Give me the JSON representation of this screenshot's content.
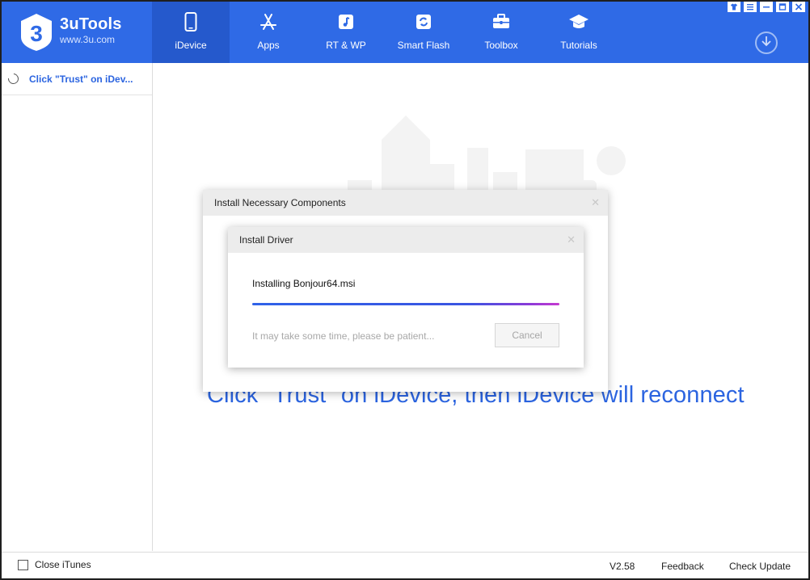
{
  "app": {
    "name": "3uTools",
    "url": "www.3u.com",
    "accent": "#2f6ae6"
  },
  "nav": {
    "items": [
      {
        "label": "iDevice",
        "icon": "phone-icon",
        "active": true
      },
      {
        "label": "Apps",
        "icon": "app-store-icon",
        "active": false
      },
      {
        "label": "RT & WP",
        "icon": "music-icon",
        "active": false
      },
      {
        "label": "Smart Flash",
        "icon": "refresh-icon",
        "active": false
      },
      {
        "label": "Toolbox",
        "icon": "toolbox-icon",
        "active": false
      },
      {
        "label": "Tutorials",
        "icon": "graduation-cap-icon",
        "active": false
      }
    ]
  },
  "sidebar": {
    "items": [
      {
        "label": "Click \"Trust\" on iDev...",
        "icon": "spinner-icon"
      }
    ]
  },
  "main": {
    "hint": "Click \"Trust\" on iDevice, then iDevice will reconnect"
  },
  "dialog_outer": {
    "title": "Install Necessary Components"
  },
  "dialog_inner": {
    "title": "Install Driver",
    "status": "Installing Bonjour64.msi",
    "progress": 1.0,
    "note": "It may take some time, please be patient...",
    "cancel_label": "Cancel"
  },
  "bottombar": {
    "close_itunes_label": "Close iTunes",
    "close_itunes_checked": false,
    "version": "V2.58",
    "feedback_label": "Feedback",
    "check_update_label": "Check Update"
  }
}
